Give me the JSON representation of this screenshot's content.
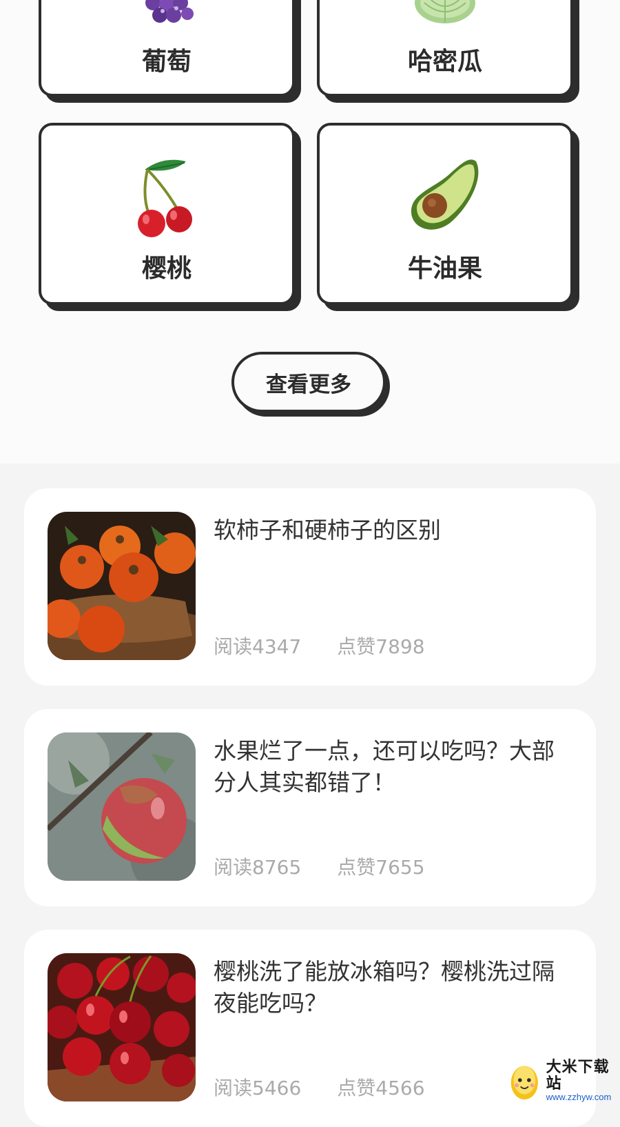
{
  "fruit_grid": {
    "items": [
      {
        "name": "葡萄",
        "icon": "grape-icon"
      },
      {
        "name": "哈密瓜",
        "icon": "cantaloupe-icon"
      },
      {
        "name": "樱桃",
        "icon": "cherry-icon"
      },
      {
        "name": "牛油果",
        "icon": "avocado-icon"
      }
    ]
  },
  "more_button": {
    "label": "查看更多"
  },
  "articles": [
    {
      "title": "软柿子和硬柿子的区别",
      "read": "阅读4347",
      "like": "点赞7898",
      "thumb": "persimmon-basket-photo"
    },
    {
      "title": "水果烂了一点，还可以吃吗？大部分人其实都错了！",
      "read": "阅读8765",
      "like": "点赞7655",
      "thumb": "apple-on-branch-photo"
    },
    {
      "title": "樱桃洗了能放冰箱吗？樱桃洗过隔夜能吃吗？",
      "read": "阅读5466",
      "like": "点赞4566",
      "thumb": "cherries-photo"
    }
  ],
  "watermark": {
    "title": "大米下载站",
    "url": "www.zzhyw.com"
  },
  "colors": {
    "card_border": "#2d2d2d",
    "stat_text": "#aaaaaa",
    "page_bg": "#f4f4f4"
  }
}
